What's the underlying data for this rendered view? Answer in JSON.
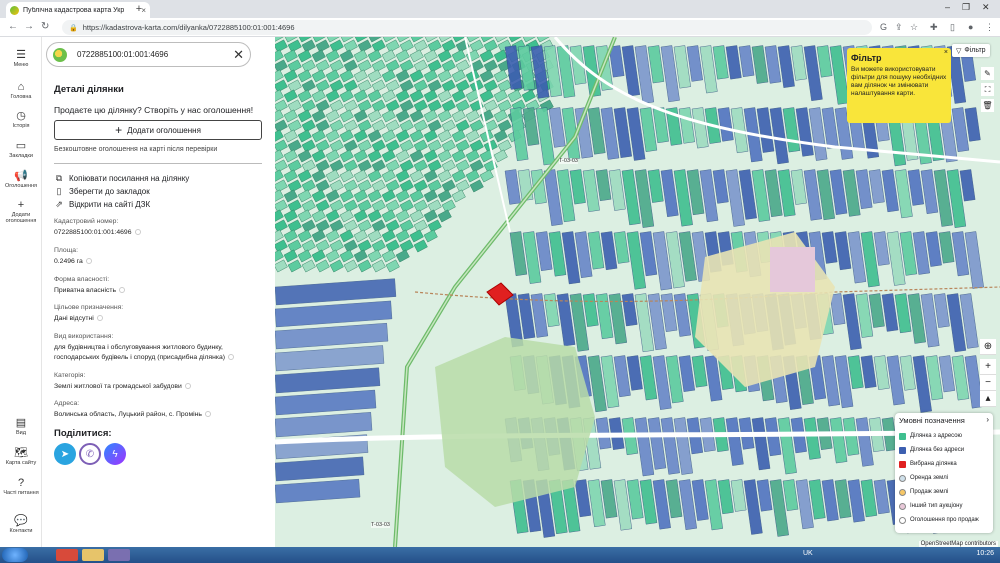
{
  "browser": {
    "tab_title": "Публічна кадастрова карта Укр",
    "url": "https://kadastrova-karta.com/dilyanka/0722885100:01:001:4696"
  },
  "rail": {
    "menu": "Меню",
    "home": "Головна",
    "history": "Історія",
    "bookmarks": "Закладки",
    "ads": "Оголошення",
    "add_ads": "Додати оголошення",
    "view": "Вид",
    "site_map": "Карта сайту",
    "faq": "Часті питання",
    "contacts": "Контакти"
  },
  "panel": {
    "search_value": "0722885100:01:001:4696",
    "title": "Деталі ділянки",
    "promo": "Продаєте цю ділянку? Створіть у нас оголошення!",
    "add_ad_button": "Додати оголошення",
    "free_note": "Безкоштовне оголошення на карті після перевірки",
    "actions": {
      "copy_link": "Копіювати посилання на ділянку",
      "save_bookmark": "Зберегти до закладок",
      "open_dzk": "Відкрити на сайті ДЗК"
    },
    "fields": [
      {
        "label": "Кадастровий номер:",
        "value": "0722885100:01:001:4696"
      },
      {
        "label": "Площа:",
        "value": "0.2496 га"
      },
      {
        "label": "Форма власності:",
        "value": "Приватна власність"
      },
      {
        "label": "Цільове призначення:",
        "value": "Дані відсутні"
      },
      {
        "label": "Вид використання:",
        "value": "для будівництва і обслуговування житлового будинку, господарських будівель і споруд (присадибна ділянка)"
      },
      {
        "label": "Категорія:",
        "value": "Землі житлової та громадської забудови"
      },
      {
        "label": "Адреса:",
        "value": "Волинська область, Луцький район, с. Промінь"
      }
    ],
    "share_title": "Поділитися:"
  },
  "map": {
    "filter_button": "Фільтр",
    "tooltip": {
      "title": "Фільтр",
      "text": "Ви можете використовувати фільтри для пошуку необхідних вам ділянок чи змінювати налаштування карти.",
      "close": "×"
    },
    "road_labels": [
      "T-03-03",
      "T-03-03"
    ],
    "legend": {
      "title": "Умовні позначення",
      "items": [
        {
          "label": "Ділянка з адресою",
          "color": "#3fbf8f"
        },
        {
          "label": "Ділянка без адреси",
          "color": "#3c5fb0"
        },
        {
          "label": "Вибрана ділянка",
          "color": "#e02020"
        },
        {
          "label": "Оренда землі",
          "color": "#cfe0ea"
        },
        {
          "label": "Продаж землі",
          "color": "#f7c766"
        },
        {
          "label": "Інший тип аукціону",
          "color": "#e8c8d8"
        },
        {
          "label": "Оголошення про продаж",
          "color": "#ffffff"
        }
      ]
    },
    "attribution": "OpenStreetMap contributors"
  },
  "taskbar": {
    "lang": "UK",
    "time": "10:26"
  }
}
